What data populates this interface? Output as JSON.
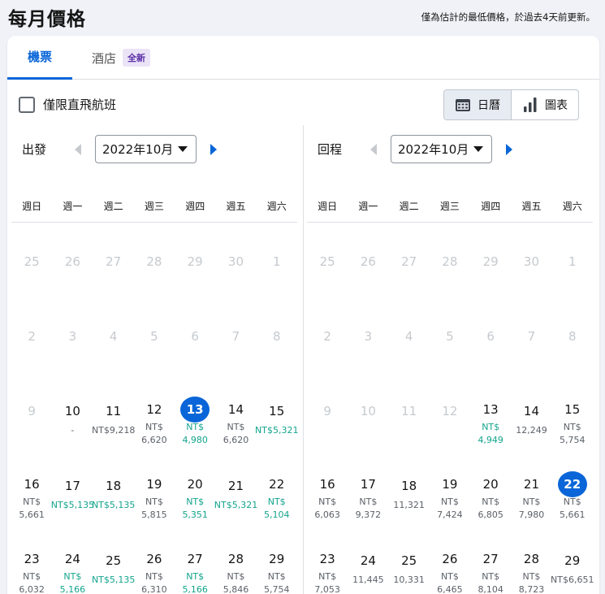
{
  "header": {
    "title": "每月價格",
    "note": "僅為估計的最低價格，於過去4天前更新。"
  },
  "tabs": [
    {
      "label": "機票",
      "active": true
    },
    {
      "label": "酒店",
      "badge": "全新",
      "active": false
    }
  ],
  "filters": {
    "direct_only_label": "僅限直飛航班",
    "direct_only_checked": false
  },
  "view_toggle": {
    "calendar_label": "日曆",
    "chart_label": "圖表",
    "active": "calendar"
  },
  "weekdays": [
    "週日",
    "週一",
    "週二",
    "週三",
    "週四",
    "週五",
    "週六"
  ],
  "colors": {
    "accent": "#0a66d8",
    "low_price": "#13a48c",
    "muted": "#c6cace"
  },
  "departure": {
    "label": "出發",
    "month": "2022年10月",
    "weeks": [
      [
        {
          "d": "25",
          "s": "out"
        },
        {
          "d": "26",
          "s": "out"
        },
        {
          "d": "27",
          "s": "out"
        },
        {
          "d": "28",
          "s": "out"
        },
        {
          "d": "29",
          "s": "out"
        },
        {
          "d": "30",
          "s": "out"
        },
        {
          "d": "1",
          "s": "disabled"
        }
      ],
      [
        {
          "d": "2",
          "s": "disabled"
        },
        {
          "d": "3",
          "s": "disabled"
        },
        {
          "d": "4",
          "s": "disabled"
        },
        {
          "d": "5",
          "s": "disabled"
        },
        {
          "d": "6",
          "s": "disabled"
        },
        {
          "d": "7",
          "s": "disabled"
        },
        {
          "d": "8",
          "s": "disabled"
        }
      ],
      [
        {
          "d": "9",
          "s": "disabled"
        },
        {
          "d": "10",
          "p": "-"
        },
        {
          "d": "11",
          "p": "NT$9,218"
        },
        {
          "d": "12",
          "p": "NT$\n6,620"
        },
        {
          "d": "13",
          "p": "NT$\n4,980",
          "low": true,
          "sel": true
        },
        {
          "d": "14",
          "p": "NT$\n6,620"
        },
        {
          "d": "15",
          "p": "NT$5,321",
          "low": true
        }
      ],
      [
        {
          "d": "16",
          "p": "NT$\n5,661"
        },
        {
          "d": "17",
          "p": "NT$5,135",
          "low": true
        },
        {
          "d": "18",
          "p": "NT$5,135",
          "low": true
        },
        {
          "d": "19",
          "p": "NT$\n5,815"
        },
        {
          "d": "20",
          "p": "NT$\n5,351",
          "low": true
        },
        {
          "d": "21",
          "p": "NT$5,321",
          "low": true
        },
        {
          "d": "22",
          "p": "NT$\n5,104",
          "low": true
        }
      ],
      [
        {
          "d": "23",
          "p": "NT$\n6,032"
        },
        {
          "d": "24",
          "p": "NT$\n5,166",
          "low": true
        },
        {
          "d": "25",
          "p": "NT$5,135",
          "low": true
        },
        {
          "d": "26",
          "p": "NT$\n6,310"
        },
        {
          "d": "27",
          "p": "NT$\n5,166",
          "low": true
        },
        {
          "d": "28",
          "p": "NT$\n5,846"
        },
        {
          "d": "29",
          "p": "NT$\n5,754"
        }
      ]
    ]
  },
  "return": {
    "label": "回程",
    "month": "2022年10月",
    "weeks": [
      [
        {
          "d": "25",
          "s": "out"
        },
        {
          "d": "26",
          "s": "out"
        },
        {
          "d": "27",
          "s": "out"
        },
        {
          "d": "28",
          "s": "out"
        },
        {
          "d": "29",
          "s": "out"
        },
        {
          "d": "30",
          "s": "out"
        },
        {
          "d": "1",
          "s": "disabled"
        }
      ],
      [
        {
          "d": "2",
          "s": "disabled"
        },
        {
          "d": "3",
          "s": "disabled"
        },
        {
          "d": "4",
          "s": "disabled"
        },
        {
          "d": "5",
          "s": "disabled"
        },
        {
          "d": "6",
          "s": "disabled"
        },
        {
          "d": "7",
          "s": "disabled"
        },
        {
          "d": "8",
          "s": "disabled"
        }
      ],
      [
        {
          "d": "9",
          "s": "disabled"
        },
        {
          "d": "10",
          "s": "disabled"
        },
        {
          "d": "11",
          "s": "disabled"
        },
        {
          "d": "12",
          "s": "disabled"
        },
        {
          "d": "13",
          "p": "NT$\n4,949",
          "low": true
        },
        {
          "d": "14",
          "p": "12,249"
        },
        {
          "d": "15",
          "p": "NT$\n5,754"
        }
      ],
      [
        {
          "d": "16",
          "p": "NT$\n6,063"
        },
        {
          "d": "17",
          "p": "NT$\n9,372"
        },
        {
          "d": "18",
          "p": "11,321"
        },
        {
          "d": "19",
          "p": "NT$\n7,424"
        },
        {
          "d": "20",
          "p": "NT$\n6,805"
        },
        {
          "d": "21",
          "p": "NT$\n7,980"
        },
        {
          "d": "22",
          "p": "NT$\n5,661",
          "sel": true
        }
      ],
      [
        {
          "d": "23",
          "p": "NT$\n7,053"
        },
        {
          "d": "24",
          "p": "11,445"
        },
        {
          "d": "25",
          "p": "10,331"
        },
        {
          "d": "26",
          "p": "NT$\n6,465"
        },
        {
          "d": "27",
          "p": "NT$\n8,104"
        },
        {
          "d": "28",
          "p": "NT$\n8,723"
        },
        {
          "d": "29",
          "p": "NT$6,651"
        }
      ]
    ]
  }
}
